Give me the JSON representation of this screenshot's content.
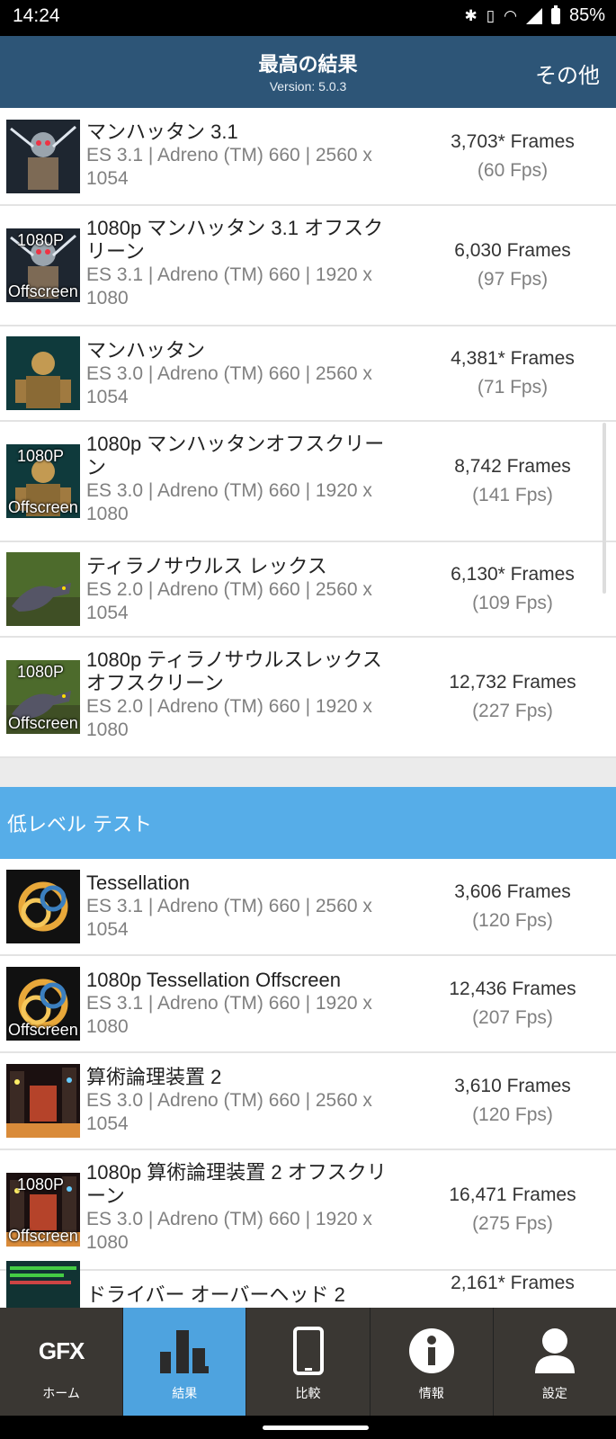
{
  "status_bar": {
    "time": "14:24",
    "battery": "85%",
    "icons": [
      "bluetooth-icon",
      "vibrate-icon",
      "wifi-icon",
      "signal-icon",
      "battery-icon"
    ]
  },
  "header": {
    "title": "最高の結果",
    "version": "Version: 5.0.3",
    "more": "その他"
  },
  "results": [
    {
      "title": "マンハッタン 3.1",
      "sub": "ES 3.1 | Adreno (TM) 660 | 2560 x 1054",
      "frames": "3,703* Frames",
      "fps": "(60 Fps)",
      "thumb": "robot"
    },
    {
      "title": "1080p マンハッタン 3.1 オフスクリーン",
      "sub": "ES 3.1 | Adreno (TM) 660 | 1920 x 1080",
      "frames": "6,030 Frames",
      "fps": "(97 Fps)",
      "thumb": "robot",
      "tag_p": "1080P",
      "tag_o": "Offscreen"
    },
    {
      "title": "マンハッタン",
      "sub": "ES 3.0 | Adreno (TM) 660 | 2560 x 1054",
      "frames": "4,381* Frames",
      "fps": "(71 Fps)",
      "thumb": "robot2"
    },
    {
      "title": "1080p マンハッタンオフスクリーン",
      "sub": "ES 3.0 | Adreno (TM) 660 | 1920 x 1080",
      "frames": "8,742 Frames",
      "fps": "(141 Fps)",
      "thumb": "robot2",
      "tag_p": "1080P",
      "tag_o": "Offscreen"
    },
    {
      "title": "ティラノサウルス レックス",
      "sub": "ES 2.0 | Adreno (TM) 660 | 2560 x 1054",
      "frames": "6,130* Frames",
      "fps": "(109 Fps)",
      "thumb": "dino"
    },
    {
      "title": "1080p ティラノサウルスレックスオフスクリーン",
      "sub": "ES 2.0 | Adreno (TM) 660 | 1920 x 1080",
      "frames": "12,732 Frames",
      "fps": "(227 Fps)",
      "thumb": "dino",
      "tag_p": "1080P",
      "tag_o": "Offscreen"
    }
  ],
  "section_low": "低レベル テスト",
  "low_results": [
    {
      "title": "Tessellation",
      "sub": "ES 3.1 | Adreno (TM) 660 | 2560 x 1054",
      "frames": "3,606 Frames",
      "fps": "(120 Fps)",
      "thumb": "knot"
    },
    {
      "title": "1080p Tessellation Offscreen",
      "sub": "ES 3.1 | Adreno (TM) 660 | 1920 x 1080",
      "frames": "12,436 Frames",
      "fps": "(207 Fps)",
      "thumb": "knot",
      "tag_o": "Offscreen"
    },
    {
      "title": "算術論理装置 2",
      "sub": "ES 3.0 | Adreno (TM) 660 | 2560 x 1054",
      "frames": "3,610 Frames",
      "fps": "(120 Fps)",
      "thumb": "city"
    },
    {
      "title": "1080p 算術論理装置 2 オフスクリーン",
      "sub": "ES 3.0 | Adreno (TM) 660 | 1920 x 1080",
      "frames": "16,471 Frames",
      "fps": "(275 Fps)",
      "thumb": "city",
      "tag_p": "1080P",
      "tag_o": "Offscreen"
    },
    {
      "title": "ドライバー オーバーヘッド 2",
      "sub": "",
      "frames": "2,161* Frames",
      "fps": "",
      "thumb": "bars"
    }
  ],
  "nav": [
    {
      "label": "ホーム",
      "icon": "gfx-logo-icon",
      "text": "GFX"
    },
    {
      "label": "結果",
      "icon": "bar-chart-icon",
      "active": true
    },
    {
      "label": "比較",
      "icon": "phone-icon"
    },
    {
      "label": "情報",
      "icon": "info-icon"
    },
    {
      "label": "設定",
      "icon": "user-icon"
    }
  ]
}
